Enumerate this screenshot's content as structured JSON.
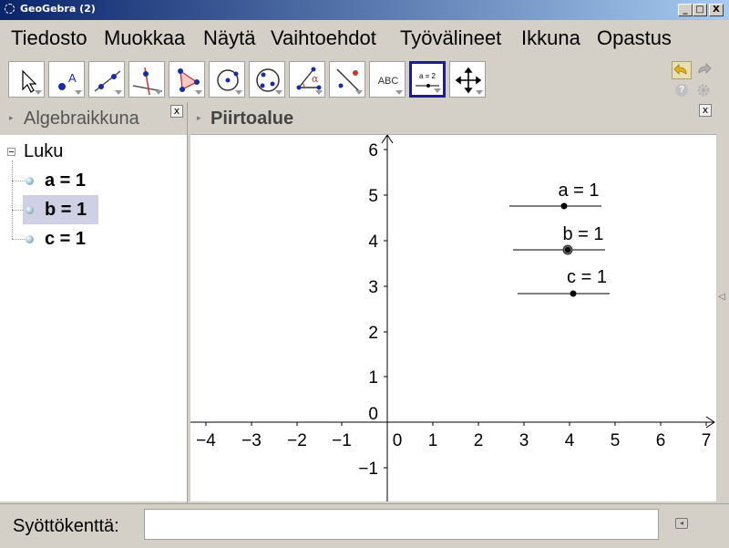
{
  "window": {
    "title": "GeoGebra (2)",
    "minimize": "_",
    "maximize": "□",
    "close": "X"
  },
  "menu": [
    "Tiedosto",
    "Muokkaa",
    "Näytä",
    "Vaihtoehdot",
    "Työvälineet",
    "Ikkuna",
    "Opastus"
  ],
  "toolbar": {
    "tools": [
      "move-tool",
      "point-tool",
      "line-tool",
      "perpendicular-tool",
      "polygon-tool",
      "circle-tool",
      "conic-tool",
      "angle-tool",
      "reflect-tool",
      "text-tool",
      "slider-tool",
      "move-view-tool"
    ],
    "text_tool_label": "ABC",
    "slider_tool_label": "a = 2",
    "selected_tool": "slider-tool"
  },
  "algebra": {
    "title": "Algebraikkuna",
    "close": "x",
    "group": "Luku",
    "items": [
      "a = 1",
      "b = 1",
      "c = 1"
    ],
    "selected_item": "b = 1"
  },
  "graphics": {
    "title": "Piirtoalue",
    "close": "x",
    "x_ticks": [
      "−4",
      "−3",
      "−2",
      "−1",
      "0",
      "1",
      "2",
      "3",
      "4",
      "5",
      "6",
      "7"
    ],
    "y_ticks": [
      "6",
      "5",
      "4",
      "3",
      "2",
      "1",
      "0",
      "−1"
    ],
    "sliders": [
      {
        "label": "a = 1",
        "value": 1
      },
      {
        "label": "b = 1",
        "value": 1
      },
      {
        "label": "c = 1",
        "value": 1
      }
    ]
  },
  "input": {
    "label": "Syöttökenttä:",
    "value": ""
  }
}
